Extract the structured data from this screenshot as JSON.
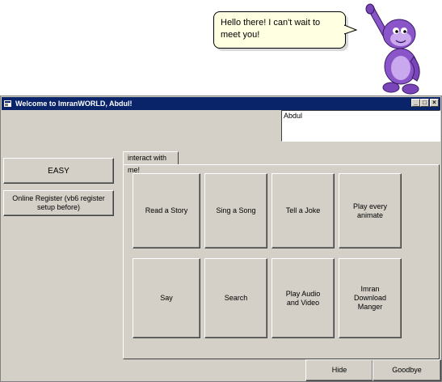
{
  "agent": {
    "balloon_text": "Hello there! I can't wait to meet you!",
    "character_icon": "purple-gorilla-agent-icon"
  },
  "window": {
    "title": "Welcome to ImranWORLD, Abdul!",
    "controls": {
      "minimize": "_",
      "maximize": "□",
      "close": "×"
    }
  },
  "name_box": {
    "value": "Abdul"
  },
  "sidebar": {
    "easy_label": "EASY",
    "register_label": "Online Register (vb6 register setup before)"
  },
  "tab": {
    "label": "interact with me!"
  },
  "actions": {
    "read_story": "Read a Story",
    "sing_song": "Sing a Song",
    "tell_joke": "Tell a Joke",
    "play_animate": "Play every animate",
    "say": "Say",
    "search": "Search",
    "play_audio": "Play Audio and Video",
    "download_manager": "Imran Download Manger"
  },
  "footer": {
    "hide_label": "Hide",
    "goodbye_label": "Goodbye"
  },
  "colors": {
    "face": "#d4d0c8",
    "title_bar": "#0a246a",
    "balloon": "#ffffe1",
    "agent_purple": "#8a55c9"
  }
}
